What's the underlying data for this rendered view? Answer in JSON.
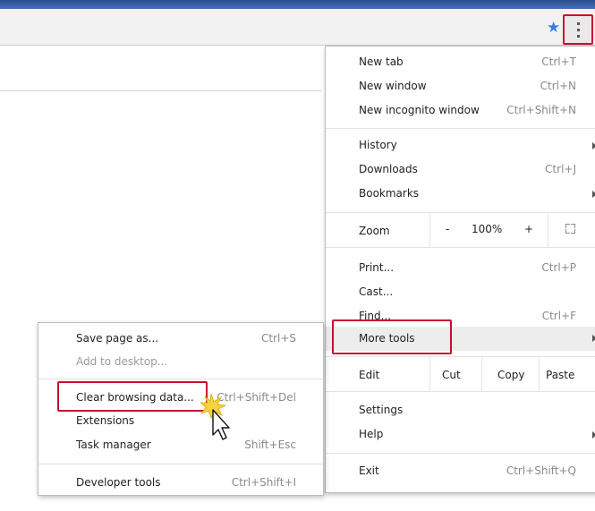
{
  "main_menu": {
    "new_tab": {
      "label": "New tab",
      "shortcut": "Ctrl+T"
    },
    "new_window": {
      "label": "New window",
      "shortcut": "Ctrl+N"
    },
    "new_incognito": {
      "label": "New incognito window",
      "shortcut": "Ctrl+Shift+N"
    },
    "history": {
      "label": "History"
    },
    "downloads": {
      "label": "Downloads",
      "shortcut": "Ctrl+J"
    },
    "bookmarks": {
      "label": "Bookmarks"
    },
    "zoom": {
      "label": "Zoom",
      "minus": "-",
      "level": "100%",
      "plus": "+"
    },
    "print": {
      "label": "Print...",
      "shortcut": "Ctrl+P"
    },
    "cast": {
      "label": "Cast..."
    },
    "find": {
      "label": "Find...",
      "shortcut": "Ctrl+F"
    },
    "more_tools": {
      "label": "More tools"
    },
    "edit": {
      "label": "Edit",
      "cut": "Cut",
      "copy": "Copy",
      "paste": "Paste"
    },
    "settings": {
      "label": "Settings"
    },
    "help": {
      "label": "Help"
    },
    "exit": {
      "label": "Exit",
      "shortcut": "Ctrl+Shift+Q"
    }
  },
  "sub_menu": {
    "save_page": {
      "label": "Save page as...",
      "shortcut": "Ctrl+S"
    },
    "add_desktop": {
      "label": "Add to desktop..."
    },
    "clear_browsing": {
      "label": "Clear browsing data...",
      "shortcut": "Ctrl+Shift+Del"
    },
    "extensions": {
      "label": "Extensions"
    },
    "task_manager": {
      "label": "Task manager",
      "shortcut": "Shift+Esc"
    },
    "developer_tools": {
      "label": "Developer tools",
      "shortcut": "Ctrl+Shift+I"
    }
  },
  "icons": {
    "bookmark": "star-icon",
    "menu": "kebab-menu-icon",
    "fullscreen": "fullscreen-icon",
    "pointer": "mouse-cursor-icon"
  },
  "colors": {
    "highlight_box": "#c8102e",
    "star": "#3b7ae8",
    "menu_hover": "#ededed"
  }
}
